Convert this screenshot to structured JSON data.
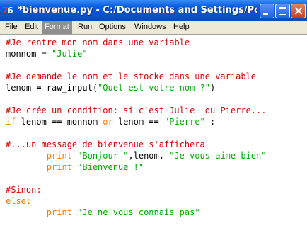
{
  "window": {
    "title": "*bienvenue.py - C:/Documents and Settings/Pc/Bure...",
    "app_icon_text_1": "7",
    "app_icon_text_2": "6",
    "buttons": [
      "minimize-icon",
      "maximize-icon",
      "close-icon"
    ]
  },
  "menubar": {
    "items": [
      {
        "label": "File"
      },
      {
        "label": "Edit"
      },
      {
        "label": "Format",
        "active": true
      },
      {
        "label": "Run"
      },
      {
        "label": "Options"
      },
      {
        "label": "Windows"
      },
      {
        "label": "Help"
      }
    ]
  },
  "code": {
    "l1": "#Je rentre mon nom dans une variable",
    "l2_var": "monnom = ",
    "l2_str": "\"Julie\"",
    "l4": "#Je demande le nom et le stocke dans une variable",
    "l5_a": "lenom = raw_input(",
    "l5_str": "\"Quel est votre nom ?\"",
    "l5_b": ")",
    "l7": "#Je crée un condition: si c'est Julie  ou Pierre...",
    "l8_if": "if",
    "l8_a": " lenom == monnom ",
    "l8_or": "or",
    "l8_b": " lenom == ",
    "l8_str": "\"Pierre\"",
    "l8_c": " :",
    "l10": "#...un message de bienvenue s'affichera",
    "l11_indent": "        ",
    "l11_print": "print",
    "l11_s1": " \"Bonjour \"",
    "l11_a": ",lenom, ",
    "l11_s2": "\"Je vous aime bien\"",
    "l12_indent": "        ",
    "l12_print": "print",
    "l12_s": " \"Bienvenue !\"",
    "l14": "#Sinon:",
    "l15": "else:",
    "l16_indent": "        ",
    "l16_print": "print",
    "l16_s": " \"Je ne vous connais pas\""
  },
  "colors": {
    "comment": "#dd0000",
    "string": "#00aa00",
    "keyword": "#ff7700",
    "titlebar": "#0553d8"
  }
}
